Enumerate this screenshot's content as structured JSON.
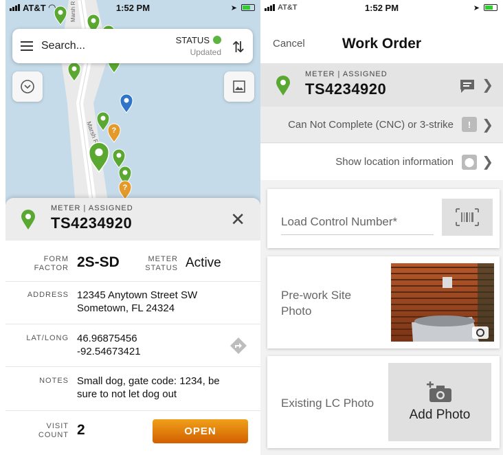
{
  "left": {
    "statusbar": {
      "carrier": "AT&T",
      "time": "1:52 PM"
    },
    "map": {
      "road_label": "Marsh R",
      "road_label_top": "Marsh R"
    },
    "search": {
      "placeholder": "Search...",
      "status_label": "STATUS",
      "status_text": "Updated",
      "status_color": "#5bb540"
    },
    "sheet": {
      "sub": "METER | ASSIGNED",
      "meter_id": "TS4234920",
      "form_factor_label": [
        "FORM",
        "FACTOR"
      ],
      "form_factor": "2S-SD",
      "meter_status_label": [
        "METER",
        "STATUS"
      ],
      "meter_status": "Active",
      "address_label": "ADDRESS",
      "address": [
        "12345 Anytown Street SW",
        "Sometown, FL 24324"
      ],
      "latlong_label": "LAT/LONG",
      "latlong": [
        "46.96875456",
        "-92.54673421"
      ],
      "notes_label": "NOTES",
      "notes": [
        "Small dog, gate code: 1234, be",
        "sure to not let dog out"
      ],
      "visit_count_label": [
        "VISIT",
        "COUNT"
      ],
      "visit_count": "2",
      "open_button": "OPEN"
    }
  },
  "right": {
    "statusbar": {
      "carrier": "AT&T",
      "time": "1:52 PM"
    },
    "navbar": {
      "cancel": "Cancel",
      "title": "Work Order"
    },
    "header": {
      "sub": "METER | ASSIGNED",
      "meter_id": "TS4234920"
    },
    "cnc_row": "Can Not Complete (CNC) or 3-strike",
    "location_row": "Show location information",
    "load_control_placeholder": "Load Control Number*",
    "prework_photo_label": [
      "Pre-work Site",
      "Photo"
    ],
    "existing_lc_label": "Existing LC Photo",
    "add_photo": "Add Photo"
  },
  "colors": {
    "pin_green": "#5aa832",
    "pin_orange": "#e49a2a",
    "pin_blue": "#2f74c9",
    "open_button": "#e07b0f"
  }
}
